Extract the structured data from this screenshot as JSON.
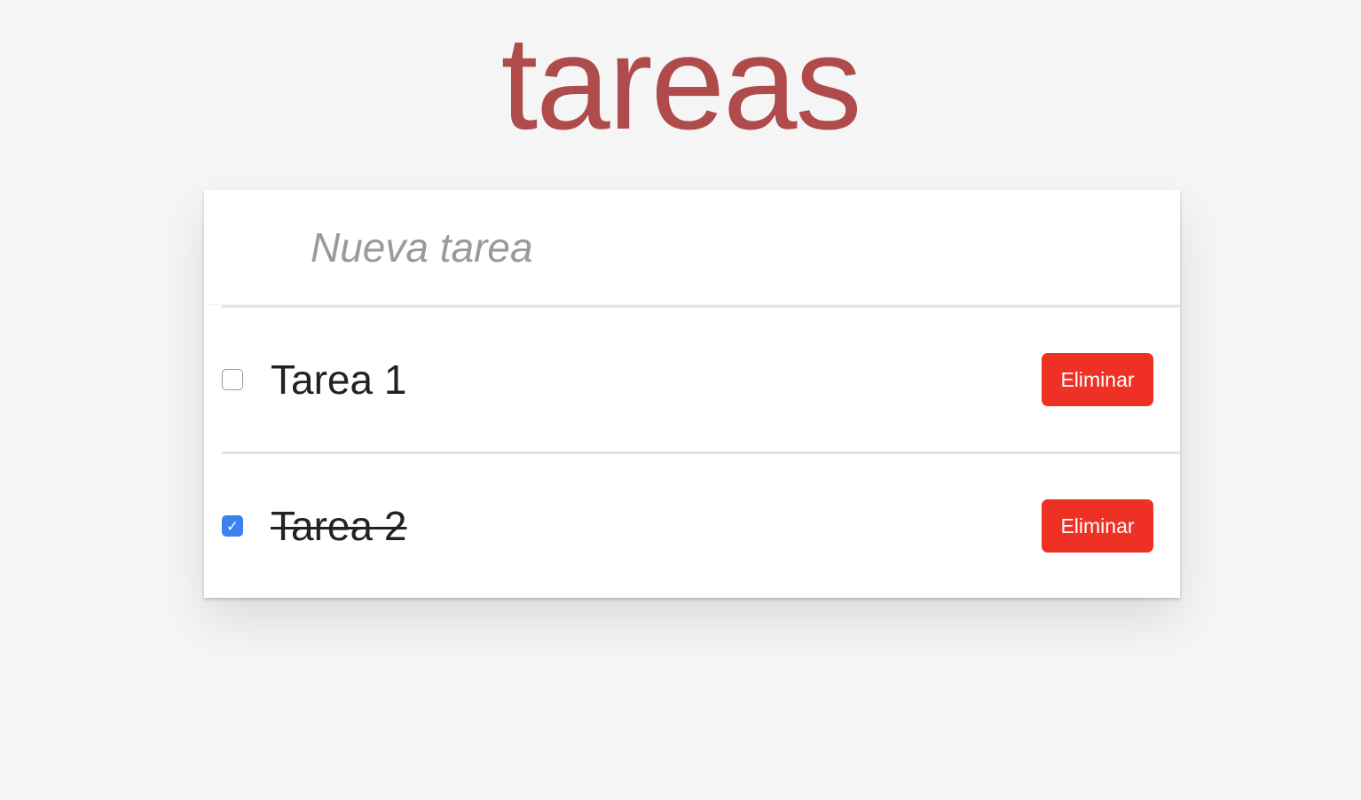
{
  "header": {
    "title": "tareas"
  },
  "new_todo": {
    "placeholder": "Nueva tarea",
    "value": ""
  },
  "todos": [
    {
      "label": "Tarea 1",
      "completed": false,
      "delete_label": "Eliminar"
    },
    {
      "label": "Tarea 2",
      "completed": true,
      "delete_label": "Eliminar"
    }
  ],
  "colors": {
    "title": "#af4b4b",
    "delete_button": "#ee3124",
    "checkbox_checked": "#3b82f0",
    "background": "#f5f5f5"
  }
}
